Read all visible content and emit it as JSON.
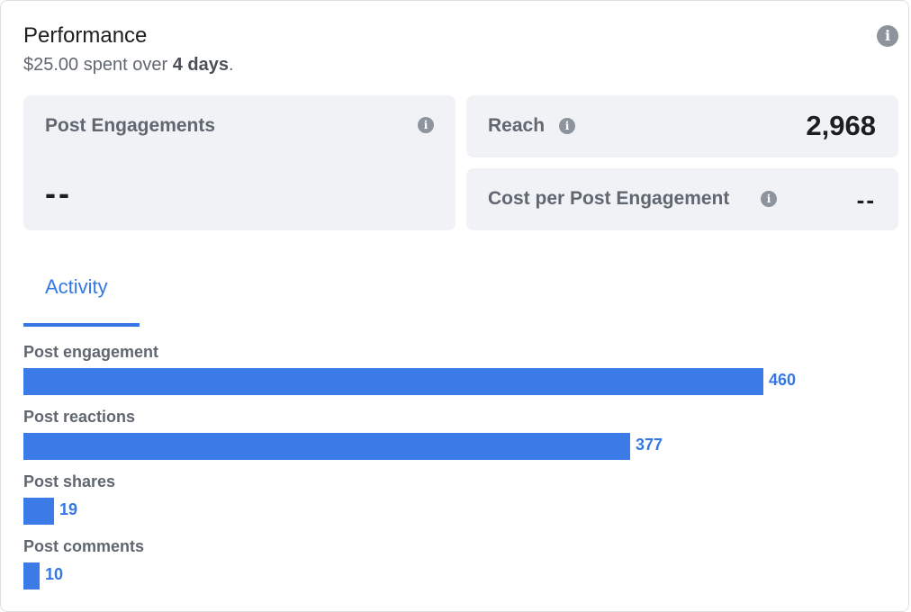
{
  "header": {
    "title": "Performance",
    "spent_amount": "$25.00",
    "spent_text": " spent over ",
    "days": "4 days",
    "period": ".",
    "info_icon": "info-icon"
  },
  "metrics": {
    "post_engagements": {
      "label": "Post Engagements",
      "value": "--"
    },
    "reach": {
      "label": "Reach",
      "value": "2,968"
    },
    "cost_per_engagement": {
      "label": "Cost per Post Engagement",
      "value": "--"
    }
  },
  "tabs": [
    {
      "label": "Activity",
      "active": true
    }
  ],
  "colors": {
    "accent": "#3578e5",
    "bar": "#3b7be8",
    "card_bg": "#f0f2f5",
    "muted_text": "#606770"
  },
  "chart_data": {
    "type": "bar",
    "orientation": "horizontal",
    "categories": [
      "Post engagement",
      "Post reactions",
      "Post shares",
      "Post comments"
    ],
    "values": [
      460,
      377,
      19,
      10
    ],
    "title": "",
    "xlim": [
      0,
      460
    ]
  }
}
